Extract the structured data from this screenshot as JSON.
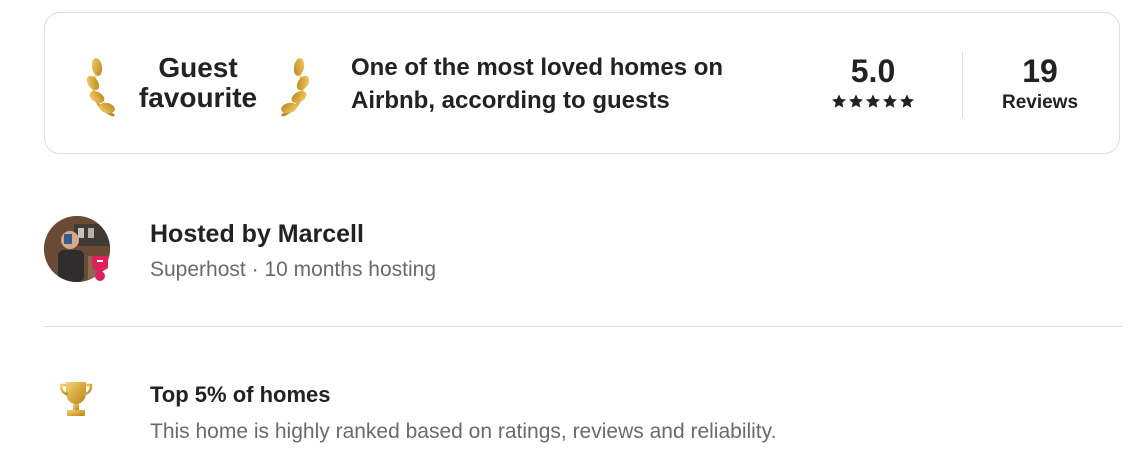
{
  "guest_favourite": {
    "badge_line1": "Guest",
    "badge_line2": "favourite",
    "tagline": "One of the most loved homes on Airbnb, according to guests",
    "rating": "5.0",
    "stars": 5,
    "reviews_count": "19",
    "reviews_label": "Reviews",
    "icons": [
      "laurel-left-icon",
      "laurel-right-icon",
      "star-icon"
    ]
  },
  "host": {
    "name_line": "Hosted by Marcell",
    "sub_line": "Superhost · 10 months hosting",
    "icons": [
      "avatar",
      "superhost-badge-icon"
    ]
  },
  "highlight": {
    "title": "Top 5% of homes",
    "description": "This home is highly ranked based on ratings, reviews and reliability.",
    "icon": "trophy-icon"
  },
  "colors": {
    "text_primary": "#222222",
    "text_secondary": "#6a6a6a",
    "border": "#dddddd",
    "gold": "#e0b23a",
    "superhost_pink": "#e0205a"
  }
}
